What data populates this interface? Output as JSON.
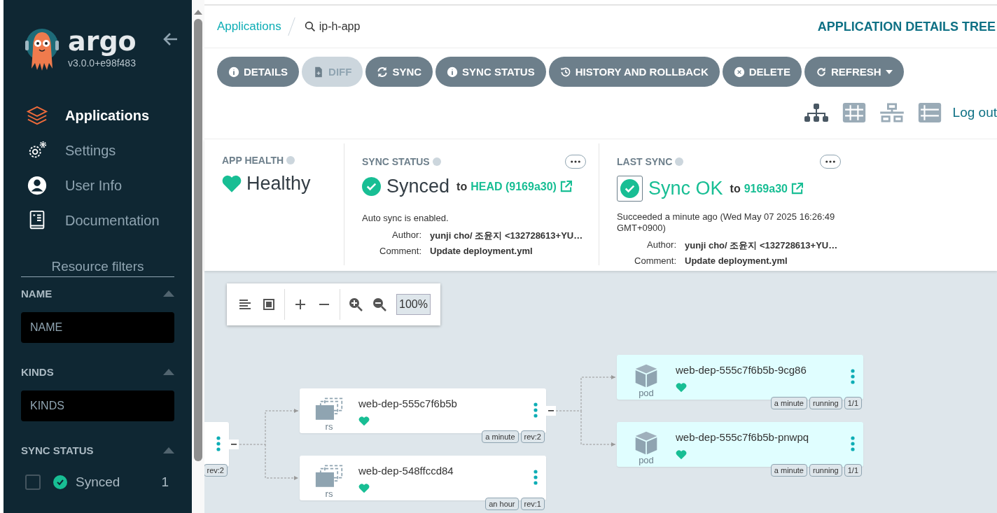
{
  "sidebar": {
    "logo_text": "argo",
    "version": "v3.0.0+e98f483",
    "nav": [
      {
        "kind": "layers",
        "label": "Applications",
        "selected": true
      },
      {
        "kind": "gears",
        "label": "Settings",
        "selected": false
      },
      {
        "kind": "user",
        "label": "User Info",
        "selected": false
      },
      {
        "kind": "book",
        "label": "Documentation",
        "selected": false
      }
    ],
    "filters": {
      "title": "Resource filters",
      "sections": [
        {
          "kind": "text",
          "label": "NAME",
          "placeholder": "NAME"
        },
        {
          "kind": "text",
          "label": "KINDS",
          "placeholder": "KINDS"
        },
        {
          "kind": "checklist",
          "label": "SYNC STATUS",
          "options": [
            {
              "label": "Synced",
              "count": "1",
              "checked": false
            }
          ]
        }
      ]
    }
  },
  "breadcrumb": {
    "link": "Applications",
    "current": "ip-h-app"
  },
  "page_title": "APPLICATION DETAILS TREE",
  "actions": [
    {
      "kind": "info",
      "label": "DETAILS",
      "disabled": false,
      "dropdown": false
    },
    {
      "kind": "file-plus",
      "label": "DIFF",
      "disabled": true,
      "dropdown": false
    },
    {
      "kind": "sync",
      "label": "SYNC",
      "disabled": false,
      "dropdown": false
    },
    {
      "kind": "info",
      "label": "SYNC STATUS",
      "disabled": false,
      "dropdown": false
    },
    {
      "kind": "history",
      "label": "HISTORY AND ROLLBACK",
      "disabled": false,
      "dropdown": false
    },
    {
      "kind": "x-circle",
      "label": "DELETE",
      "disabled": false,
      "dropdown": false
    },
    {
      "kind": "refresh",
      "label": "REFRESH",
      "disabled": false,
      "dropdown": true
    }
  ],
  "view_modes": [
    {
      "kind": "tree",
      "selected": true
    },
    {
      "kind": "grid",
      "selected": false
    },
    {
      "kind": "network",
      "selected": false
    },
    {
      "kind": "list",
      "selected": false
    }
  ],
  "logout": "Log out",
  "status": {
    "app_health": {
      "title": "APP HEALTH",
      "value": "Healthy"
    },
    "sync_status": {
      "title": "SYNC STATUS",
      "value": "Synced",
      "to": "to",
      "target": "HEAD (9169a30)",
      "note": "Auto sync is enabled.",
      "details": [
        {
          "key": "Author:",
          "value": "yunji cho/ 조윤지 <132728613+YU…"
        },
        {
          "key": "Comment:",
          "value": "Update deployment.yml"
        }
      ]
    },
    "last_sync": {
      "title": "LAST SYNC",
      "value": "Sync OK",
      "to": "to",
      "target": "9169a30",
      "note": "Succeeded a minute ago (Wed May 07 2025 16:26:49 GMT+0900)",
      "details": [
        {
          "key": "Author:",
          "value": "yunji cho/ 조윤지 <132728613+YU…"
        },
        {
          "key": "Comment:",
          "value": "Update deployment.yml"
        }
      ]
    }
  },
  "graph": {
    "zoom": "100%",
    "nodes": [
      {
        "kind": "partial",
        "collapsible": true,
        "tags": [
          "rev:2"
        ]
      },
      {
        "kind": "rs",
        "name": "web-dep-555c7f6b5b",
        "collapsible": true,
        "tags": [
          "a minute",
          "rev:2"
        ]
      },
      {
        "kind": "rs",
        "name": "web-dep-548ffccd84",
        "collapsible": false,
        "tags": [
          "an hour",
          "rev:1"
        ]
      },
      {
        "kind": "pod",
        "name": "web-dep-555c7f6b5b-9cg86",
        "collapsible": false,
        "tags": [
          "a minute",
          "running",
          "1/1"
        ]
      },
      {
        "kind": "pod",
        "name": "web-dep-555c7f6b5b-pnwpq",
        "collapsible": false,
        "tags": [
          "a minute",
          "running",
          "1/1"
        ]
      }
    ]
  }
}
